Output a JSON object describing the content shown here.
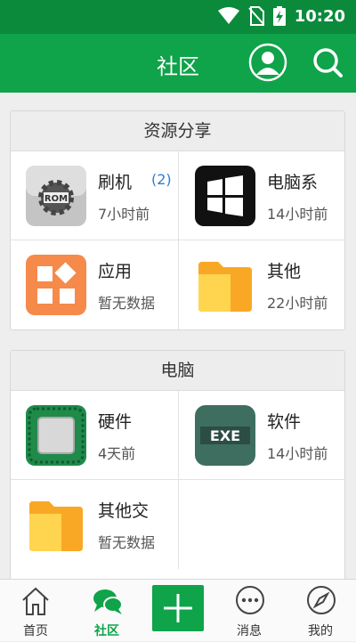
{
  "status_bar": {
    "time": "10:20",
    "icons": [
      "wifi-icon",
      "no-sim-icon",
      "battery-charging-icon"
    ]
  },
  "header": {
    "title": "社区",
    "buttons": [
      "user-avatar-icon",
      "search-icon"
    ]
  },
  "sections": [
    {
      "title": "资源分享",
      "items": [
        {
          "name": "刷机",
          "badge": "(2)",
          "time": "7小时前",
          "icon": "rom-gear-icon"
        },
        {
          "name": "电脑系",
          "time": "14小时前",
          "icon": "windows-logo-icon"
        },
        {
          "name": "应用",
          "time": "暂无数据",
          "icon": "apps-grid-icon"
        },
        {
          "name": "其他",
          "time": "22小时前",
          "icon": "folder-icon"
        }
      ]
    },
    {
      "title": "电脑",
      "items": [
        {
          "name": "硬件",
          "time": "4天前",
          "icon": "chip-icon"
        },
        {
          "name": "软件",
          "time": "14小时前",
          "icon": "exe-file-icon",
          "icon_text": "EXE"
        },
        {
          "name": "其他交",
          "time": "暂无数据",
          "icon": "folder-icon"
        }
      ]
    }
  ],
  "tabbar": {
    "items": [
      {
        "label": "首页",
        "icon": "home-icon"
      },
      {
        "label": "社区",
        "icon": "chat-bubbles-icon",
        "active": true
      },
      {
        "label": "",
        "icon": "plus-icon"
      },
      {
        "label": "消息",
        "icon": "message-icon"
      },
      {
        "label": "我的",
        "icon": "compass-icon"
      }
    ]
  },
  "colors": {
    "primary": "#0fa34a",
    "status_bar": "#0b8a3c",
    "badge": "#2a7fd4"
  }
}
